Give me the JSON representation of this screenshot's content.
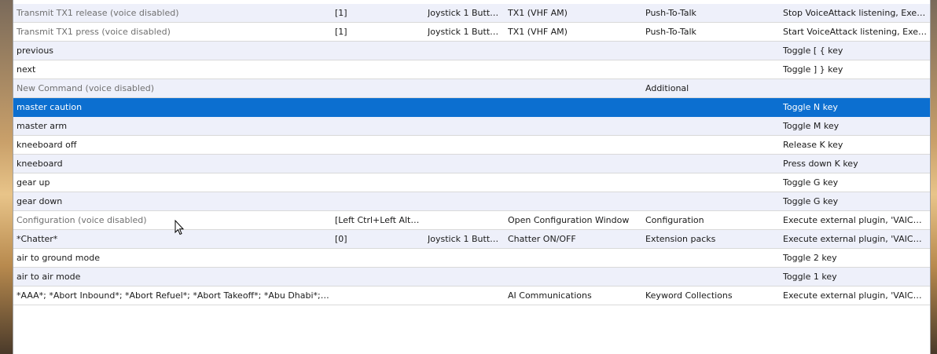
{
  "rows": [
    {
      "name": "Transmit TX1 release  (voice disabled)",
      "key": "[1]",
      "joystick": "Joystick 1 Butto...",
      "description": "TX1 (VHF AM)",
      "category": "Push-To-Talk",
      "action": "Stop VoiceAttack listening, Execut...",
      "disabled": true,
      "selected": false
    },
    {
      "name": "Transmit TX1 press  (voice disabled)",
      "key": "[1]",
      "joystick": "Joystick 1 Butto...",
      "description": "TX1 (VHF AM)",
      "category": "Push-To-Talk",
      "action": "Start VoiceAttack listening, Execut...",
      "disabled": true,
      "selected": false
    },
    {
      "name": "previous",
      "key": "",
      "joystick": "",
      "description": "",
      "category": "",
      "action": "Toggle [ { key",
      "disabled": false,
      "selected": false
    },
    {
      "name": "next",
      "key": "",
      "joystick": "",
      "description": "",
      "category": "",
      "action": "Toggle ] } key",
      "disabled": false,
      "selected": false
    },
    {
      "name": "New Command  (voice disabled)",
      "key": "",
      "joystick": "",
      "description": "",
      "category": "Additional",
      "action": "",
      "disabled": true,
      "selected": false
    },
    {
      "name": "master caution",
      "key": "",
      "joystick": "",
      "description": "",
      "category": "",
      "action": "Toggle N key",
      "disabled": false,
      "selected": true
    },
    {
      "name": "master arm",
      "key": "",
      "joystick": "",
      "description": "",
      "category": "",
      "action": "Toggle M key",
      "disabled": false,
      "selected": false
    },
    {
      "name": "kneeboard off",
      "key": "",
      "joystick": "",
      "description": "",
      "category": "",
      "action": "Release K key",
      "disabled": false,
      "selected": false
    },
    {
      "name": "kneeboard",
      "key": "",
      "joystick": "",
      "description": "",
      "category": "",
      "action": "Press down K key",
      "disabled": false,
      "selected": false
    },
    {
      "name": "gear up",
      "key": "",
      "joystick": "",
      "description": "",
      "category": "",
      "action": "Toggle G key",
      "disabled": false,
      "selected": false
    },
    {
      "name": "gear down",
      "key": "",
      "joystick": "",
      "description": "",
      "category": "",
      "action": "Toggle G key",
      "disabled": false,
      "selected": false
    },
    {
      "name": "Configuration  (voice disabled)",
      "key": "[Left Ctrl+Left Alt+C]",
      "joystick": "",
      "description": "Open Configuration Window",
      "category": "Configuration",
      "action": "Execute external plugin, 'VAICOM ...",
      "disabled": true,
      "selected": false
    },
    {
      "name": "*Chatter*",
      "key": "[0]",
      "joystick": "Joystick 1 Butto...",
      "description": "Chatter ON/OFF",
      "category": "Extension packs",
      "action": "Execute external plugin, 'VAICOM ...",
      "disabled": false,
      "selected": false
    },
    {
      "name": "air to ground mode",
      "key": "",
      "joystick": "",
      "description": "",
      "category": "",
      "action": "Toggle 2 key",
      "disabled": false,
      "selected": false
    },
    {
      "name": "air to air mode",
      "key": "",
      "joystick": "",
      "description": "",
      "category": "",
      "action": "Toggle 1 key",
      "disabled": false,
      "selected": false
    },
    {
      "name": "*AAA*; *Abort Inbound*; *Abort Refuel*; *Abort Takeoff*; *Abu Dhabi*; *Ab...",
      "key": "",
      "joystick": "",
      "description": "AI Communications",
      "category": "Keyword Collections",
      "action": "Execute external plugin, 'VAICOM ...",
      "disabled": false,
      "selected": false
    }
  ],
  "colors": {
    "selected_bg": "#0c6fd0",
    "alt_row_bg": "#eef0fa",
    "disabled_text": "#707070"
  },
  "cursor_icon": "mouse-pointer-icon"
}
